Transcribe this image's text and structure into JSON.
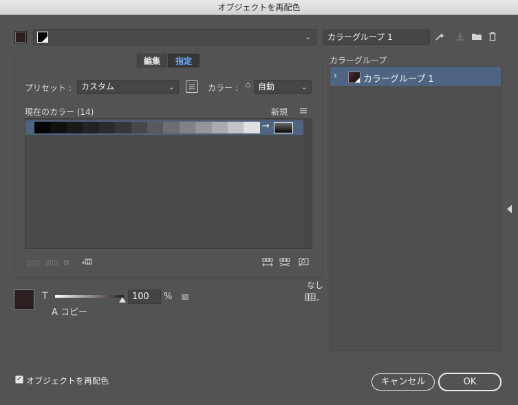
{
  "window": {
    "title": "オブジェクトを再配色"
  },
  "top": {
    "group_name_value": "カラーグループ 1",
    "icons": [
      "eyedropper-icon",
      "save-changes-icon",
      "new-group-icon",
      "trash-icon"
    ]
  },
  "tabs": [
    {
      "label": "編集",
      "active": false
    },
    {
      "label": "指定",
      "active": true
    }
  ],
  "preset": {
    "label": "プリセット :",
    "value": "カスタム"
  },
  "colors": {
    "label": "カラー :",
    "value": "自動"
  },
  "current_colors": {
    "label": "現在のカラー (14)",
    "new_label": "新規"
  },
  "gradient_steps": [
    "#050505",
    "#101010",
    "#1a1a1a",
    "#232325",
    "#2c2c2e",
    "#37373a",
    "#48484b",
    "#5a5a5e",
    "#6d6d72",
    "#818186",
    "#95959a",
    "#aaaaaf",
    "#c3c3c7",
    "#e0e0e3"
  ],
  "list_arrow": "→",
  "tint": {
    "letter": "T",
    "value": "100",
    "unit": "%",
    "ink_label": "A コピー"
  },
  "none_label": "なし",
  "right_panel": {
    "header": "カラーグループ",
    "groups": [
      {
        "name": "カラーグループ 1",
        "expand_glyph": "›"
      }
    ]
  },
  "footer": {
    "checkbox_label": "オブジェクトを再配色",
    "checkbox_checked": true,
    "cancel_label": "キャンセル",
    "ok_label": "OK"
  }
}
